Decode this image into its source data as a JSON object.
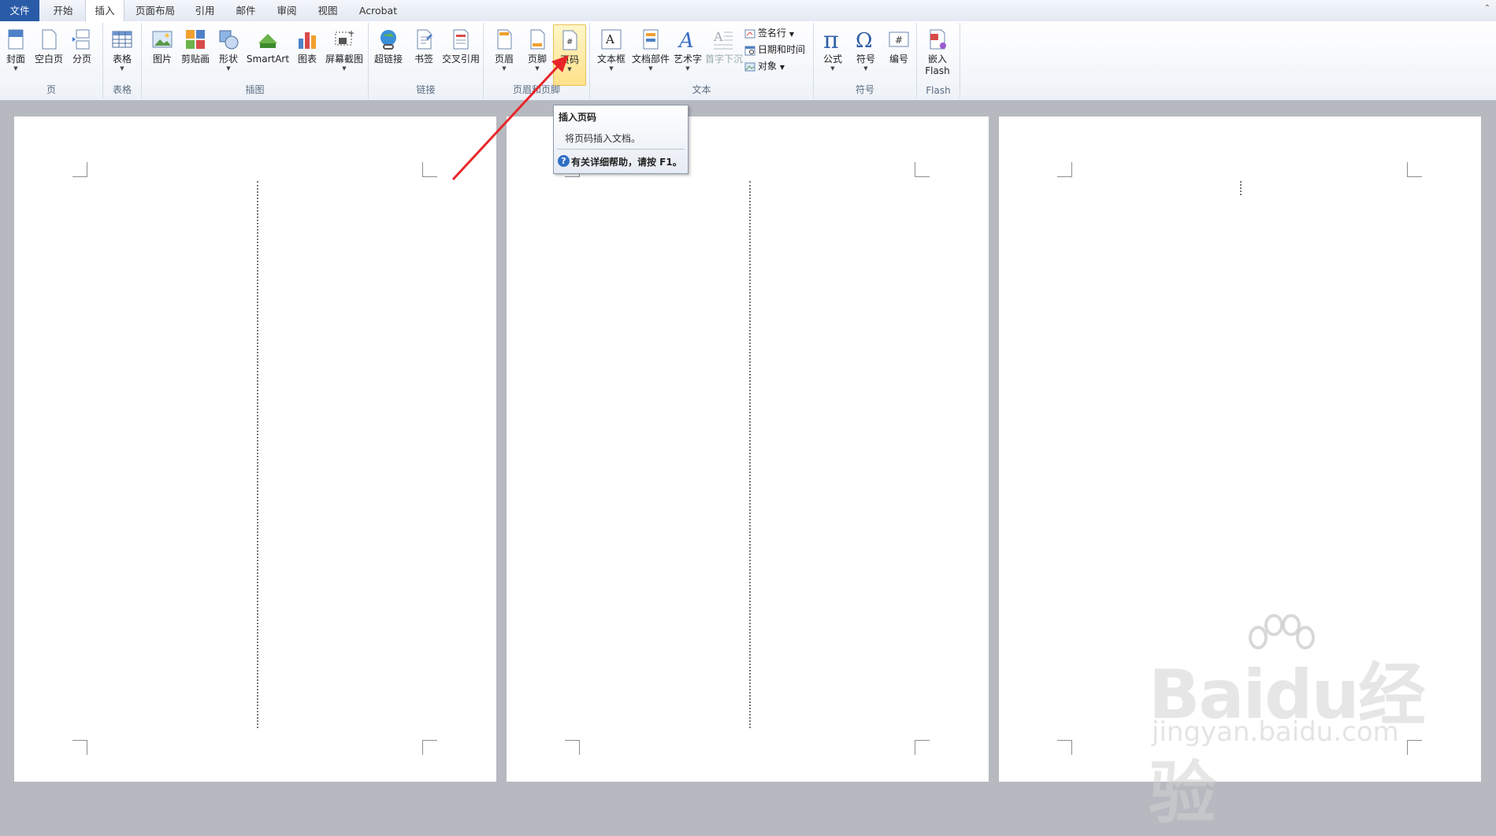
{
  "tabs": [
    {
      "label": "文件",
      "id": "file"
    },
    {
      "label": "开始",
      "id": "home"
    },
    {
      "label": "插入",
      "id": "insert"
    },
    {
      "label": "页面布局",
      "id": "layout"
    },
    {
      "label": "引用",
      "id": "refs"
    },
    {
      "label": "邮件",
      "id": "mail"
    },
    {
      "label": "审阅",
      "id": "review"
    },
    {
      "label": "视图",
      "id": "view"
    },
    {
      "label": "Acrobat",
      "id": "acrobat"
    }
  ],
  "ribbon": {
    "pages": {
      "label": "页",
      "cover": "封面",
      "blank": "空白页",
      "break": "分页"
    },
    "tables": {
      "label": "表格",
      "table": "表格"
    },
    "illustrations": {
      "label": "插图",
      "picture": "图片",
      "clipart": "剪贴画",
      "shapes": "形状",
      "smartart": "SmartArt",
      "chart": "图表",
      "screenshot": "屏幕截图"
    },
    "links": {
      "label": "链接",
      "hyperlink": "超链接",
      "bookmark": "书签",
      "crossref": "交叉引用"
    },
    "headerfooter": {
      "label": "页眉和页脚",
      "header": "页眉",
      "footer": "页脚",
      "pagenum": "页码"
    },
    "text": {
      "label": "文本",
      "textbox": "文本框",
      "quickparts": "文档部件",
      "wordart": "艺术字",
      "dropcap": "首字下沉",
      "signature": "签名行",
      "datetime": "日期和时间",
      "object": "对象"
    },
    "symbols": {
      "label": "符号",
      "equation": "公式",
      "symbol": "符号",
      "number": "编号"
    },
    "flash": {
      "label": "Flash",
      "embed_line1": "嵌入",
      "embed_line2": "Flash"
    }
  },
  "tooltip": {
    "title": "插入页码",
    "desc": "将页码插入文档。",
    "help": "有关详细帮助，请按 F1。"
  },
  "watermark": {
    "brand": "Baidu经验",
    "url": "jingyan.baidu.com"
  },
  "colors": {
    "accent": "#2a5ba7",
    "arrow": "#e8262a",
    "highlight": "#ffe18a"
  }
}
